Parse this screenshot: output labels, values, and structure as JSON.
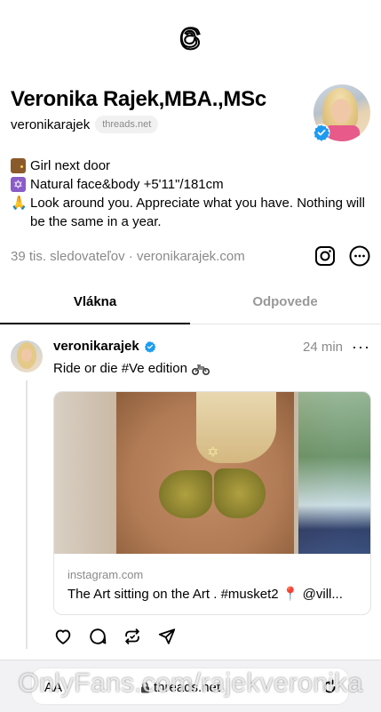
{
  "header": {
    "logo_icon": "threads-logo-icon"
  },
  "profile": {
    "display_name": "Veronika Rajek,MBA.,MSc",
    "handle": "veronikarajek",
    "handle_badge": "threads.net",
    "bio": [
      {
        "icon": "door-emoji",
        "text": "Girl next door"
      },
      {
        "icon": "star-of-david-emoji",
        "text": "Natural face&body +5'11\"/181cm"
      },
      {
        "icon": "folded-hands-emoji",
        "text": "Look around you. Appreciate what you have. Nothing will be the same in a year."
      }
    ],
    "followers": "39 tis. sledovateľov",
    "separator": "·",
    "website": "veronikarajek.com",
    "verified": true
  },
  "tabs": [
    {
      "label": "Vlákna",
      "active": true
    },
    {
      "label": "Odpovede",
      "active": false
    }
  ],
  "post": {
    "username": "veronikarajek",
    "time": "24 min",
    "more": "···",
    "text": "Ride or die #Ve edition",
    "text_emoji": "motorcycle-emoji",
    "card": {
      "domain": "instagram.com",
      "title": "The Art sitting on the Art . #musket2 📍 @vill..."
    },
    "actions": [
      "heart-icon",
      "comment-icon",
      "repost-icon",
      "share-icon"
    ]
  },
  "browser": {
    "aa_label": "AA",
    "url": "threads.net"
  },
  "watermark": "OnlyFans.com/rajekveronika",
  "colors": {
    "verified_blue": "#1d9bf0",
    "secondary_text": "#8a8a8a"
  }
}
